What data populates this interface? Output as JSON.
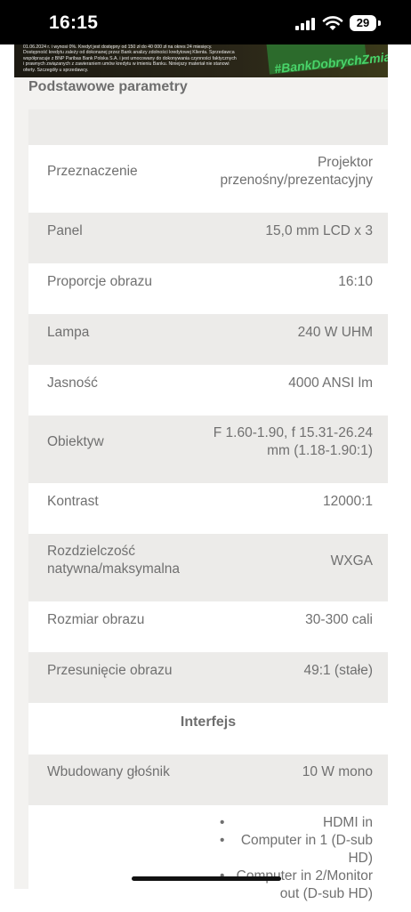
{
  "status_bar": {
    "time": "16:15",
    "battery": "29"
  },
  "banner": {
    "fine_print": "01.06.2024 r. i wynosi 0%. Kredyt jest dostępny od 150 zł do 40 000 zł na okres 24 miesięcy. Dostępność kredytu zależy od dokonanej przez Bank analizy zdolności kredytowej Klienta. Sprzedawca współpracuje z BNP Paribas Bank Polska S.A. i jest umocowany do dokonywania czynności faktycznych i prawnych związanych z zawieraniem umów kredytu w imieniu Banku. Niniejszy materiał nie stanowi oferty. Szczegóły u sprzedawcy.",
    "hashtag": "#BankDobrychZmian"
  },
  "section_title": "Podstawowe parametry",
  "rows": [
    {
      "label": "",
      "value": ""
    },
    {
      "label": "Przeznaczenie",
      "value": "Projektor przenośny/prezentacyjny"
    },
    {
      "label": "Panel",
      "value": "15,0 mm LCD x 3"
    },
    {
      "label": "Proporcje obrazu",
      "value": "16:10"
    },
    {
      "label": "Lampa",
      "value": "240 W UHM"
    },
    {
      "label": "Jasność",
      "value": "4000 ANSI lm"
    },
    {
      "label": "Obiektyw",
      "value": "F 1.60-1.90, f 15.31-26.24 mm (1.18-1.90:1)"
    },
    {
      "label": "Kontrast",
      "value": "12000:1"
    },
    {
      "label": "Rozdzielczość natywna/maksymalna",
      "value": "WXGA"
    },
    {
      "label": "Rozmiar obrazu",
      "value": "30-300 cali"
    },
    {
      "label": "Przesunięcie obrazu",
      "value": "49:1 (stałe)"
    }
  ],
  "interfaces_title": "Interfejs",
  "interface_rows": [
    {
      "label": "Wbudowany głośnik",
      "value": "10 W mono"
    }
  ],
  "interface_list": [
    "HDMI in",
    "Computer in 1 (D-sub HD)",
    "Computer in 2/Monitor out (D-sub HD)"
  ]
}
